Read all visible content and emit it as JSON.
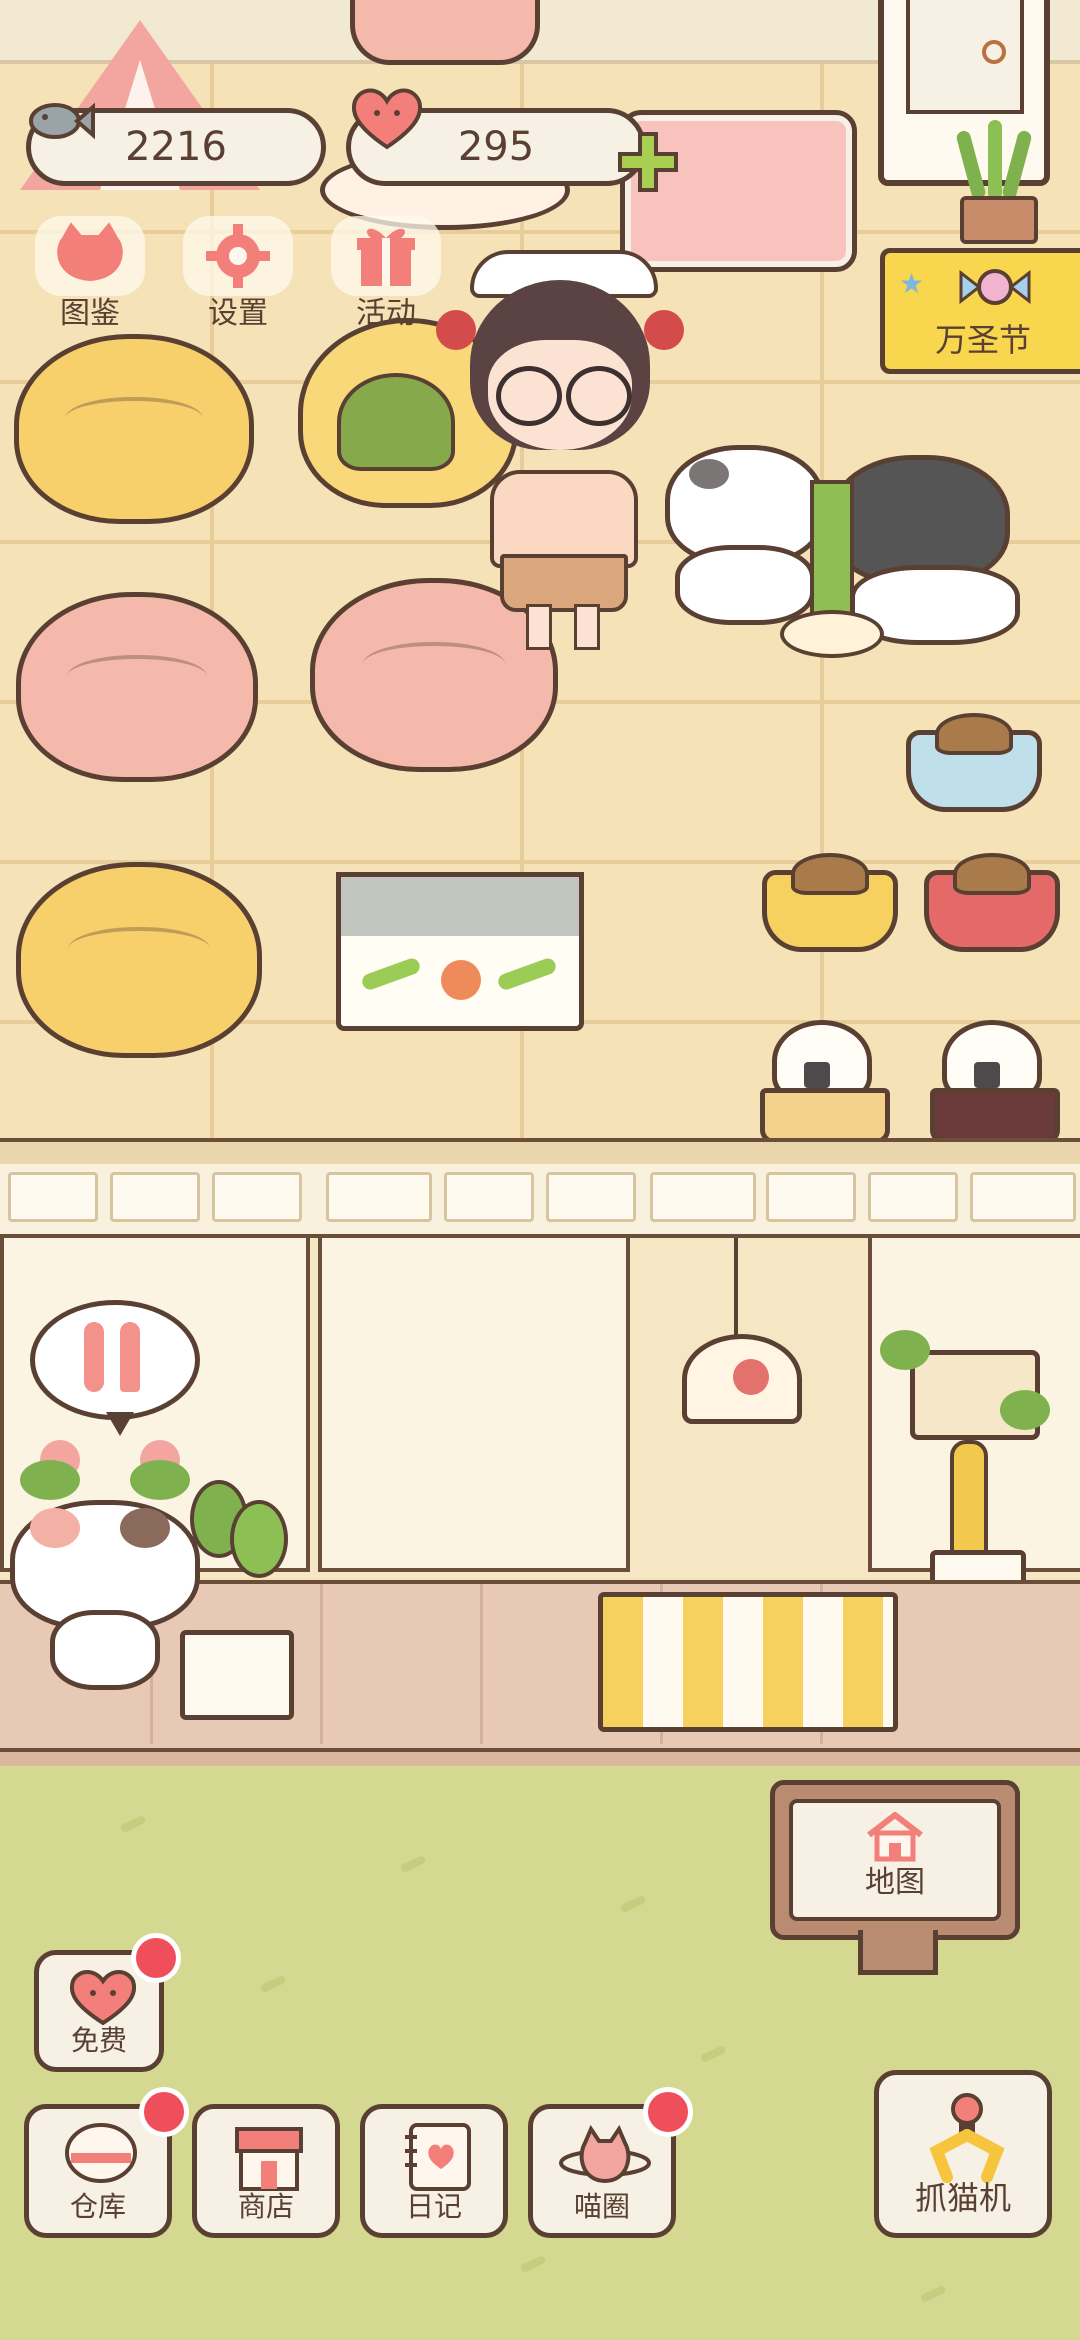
{
  "hud": {
    "fish_currency": "2216",
    "heart_currency": "295",
    "plus_symbol": "+"
  },
  "top_menu": [
    {
      "label": "图鉴",
      "icon": "cat-face-icon"
    },
    {
      "label": "设置",
      "icon": "gear-icon"
    },
    {
      "label": "活动",
      "icon": "gift-icon"
    }
  ],
  "event_banner": {
    "label": "万圣节",
    "icon": "candy-icon"
  },
  "map_sign": {
    "label": "地图",
    "icon": "house-icon"
  },
  "free_button": {
    "label": "免费",
    "icon": "heart-icon",
    "badge": true
  },
  "bottom_bar": [
    {
      "label": "仓库",
      "icon": "bowl-icon",
      "badge": true
    },
    {
      "label": "商店",
      "icon": "shop-icon",
      "badge": false
    },
    {
      "label": "日记",
      "icon": "notebook-icon",
      "badge": false
    },
    {
      "label": "喵圈",
      "icon": "cat-planet-icon",
      "badge": true
    }
  ],
  "claw_machine": {
    "label": "抓猫机",
    "icon": "claw-icon"
  },
  "colors": {
    "outline": "#5a4033",
    "badge_red": "#ef4f5a",
    "heart_pink": "#f27f79",
    "event_yellow": "#f8d64d"
  }
}
